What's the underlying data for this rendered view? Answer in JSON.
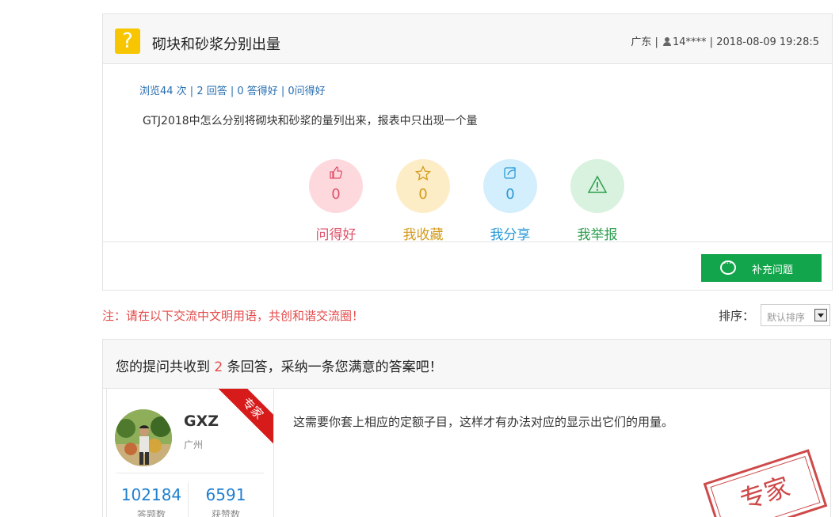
{
  "question": {
    "title": "砌块和砂浆分别出量",
    "region": "广东 |",
    "user": "14**** |",
    "time": "2018-08-09 19:28:5",
    "stats": "浏览44 次 | 2 回答 | 0 答得好 | 0问得好",
    "body": "GTJ2018中怎么分别将砌块和砂浆的量列出来，报表中只出现一个量",
    "actions": [
      {
        "count": "0",
        "label": "问得好",
        "icon": "thumbs-up-icon"
      },
      {
        "count": "0",
        "label": "我收藏",
        "icon": "star-icon"
      },
      {
        "count": "0",
        "label": "我分享",
        "icon": "share-icon"
      },
      {
        "count": "",
        "label": "我举报",
        "icon": "warning-icon"
      }
    ],
    "supplement_button": "补充问题"
  },
  "notice": "注：请在以下交流中文明用语，共创和谐交流圈！",
  "sort": {
    "label": "排序：",
    "value": "默认排序"
  },
  "answers": {
    "header_prefix": "您的提问共收到",
    "count": "2",
    "header_suffix": "条回答，采纳一条您满意的答案吧！",
    "items": [
      {
        "name": "GXZ",
        "city": "广州",
        "badge": "专家",
        "stat1": "102184",
        "stat1_label": "答题数",
        "stat2": "6591",
        "stat2_label": "获赞数",
        "text": "这需要你套上相应的定额子目，这样才有办法对应的显示出它们的用量。",
        "stamp": "专家"
      }
    ]
  },
  "colors": {
    "accent_green": "#13a54b",
    "question_icon": "#f7c600",
    "notice_red": "#e54a4a",
    "link_blue": "#2a6fb0"
  }
}
